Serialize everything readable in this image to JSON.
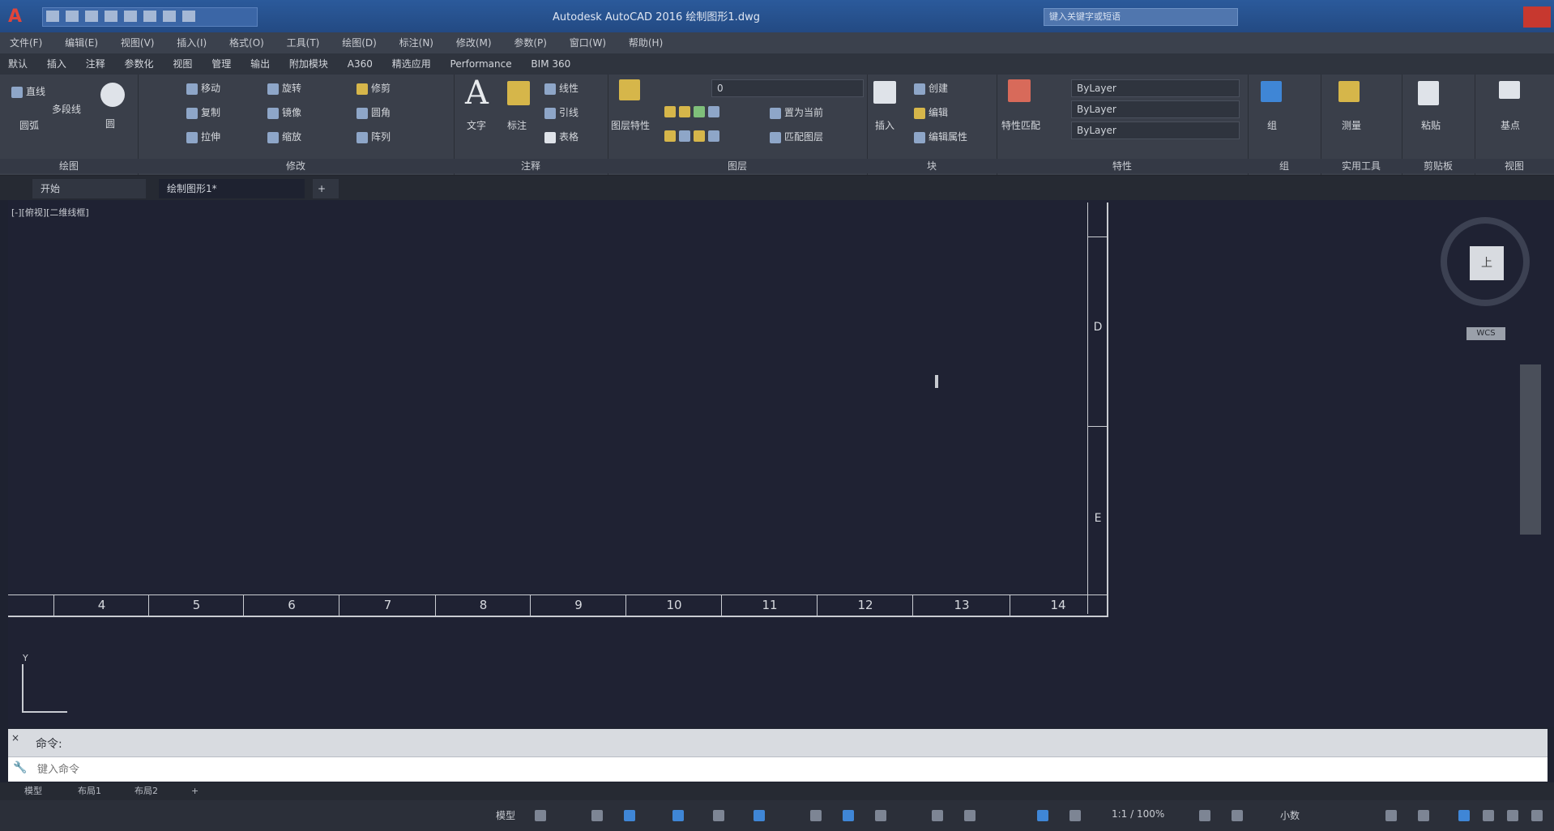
{
  "titlebar": {
    "app_logo": "A",
    "window_title": "Autodesk AutoCAD 2016   绘制图形1.dwg",
    "search_placeholder": "键入关键字或短语"
  },
  "menu": [
    "文件(F)",
    "编辑(E)",
    "视图(V)",
    "插入(I)",
    "格式(O)",
    "工具(T)",
    "绘图(D)",
    "标注(N)",
    "修改(M)",
    "参数(P)",
    "窗口(W)",
    "帮助(H)"
  ],
  "ribbon_tabs": [
    "默认",
    "插入",
    "注释",
    "参数化",
    "视图",
    "管理",
    "输出",
    "附加模块",
    "A360",
    "精选应用",
    "Performance",
    "BIM 360"
  ],
  "ribbon": {
    "draw": {
      "title": "绘图",
      "line": "直线",
      "polyline": "多段线",
      "circle": "圆",
      "arc": "圆弧"
    },
    "modify": {
      "title": "修改",
      "move": "移动",
      "rotate": "旋转",
      "trim": "修剪",
      "copy": "复制",
      "mirror": "镜像",
      "fillet": "圆角",
      "stretch": "拉伸",
      "scale": "缩放",
      "array": "阵列"
    },
    "annotation": {
      "title": "注释",
      "text": "文字",
      "dimension": "标注",
      "linear": "线性",
      "leader": "引线",
      "table": "表格"
    },
    "layers": {
      "title": "图层",
      "layer_properties": "图层特性",
      "current_layer": "0",
      "make_current": "置为当前",
      "match_layer": "匹配图层"
    },
    "block": {
      "title": "块",
      "insert": "插入",
      "create": "创建",
      "edit": "编辑",
      "edit_attributes": "编辑属性"
    },
    "properties": {
      "title": "特性",
      "match": "特性匹配",
      "color": "ByLayer",
      "linetype": "ByLayer",
      "lineweight": "ByLayer"
    },
    "groups": {
      "title": "组",
      "group": "组"
    },
    "utilities": {
      "title": "实用工具",
      "measure": "测量"
    },
    "clipboard": {
      "title": "剪贴板",
      "paste": "粘贴"
    },
    "view": {
      "title": "视图",
      "base": "基点"
    }
  },
  "file_tabs": [
    "开始",
    "绘制图形1*"
  ],
  "viewport_label": "[-][俯视][二维线框]",
  "drawing": {
    "vertical_marks": [
      "D",
      "E"
    ],
    "horizontal_marks": [
      "4",
      "5",
      "6",
      "7",
      "8",
      "9",
      "10",
      "11",
      "12",
      "13",
      "14"
    ]
  },
  "navigation": {
    "cube_face": "上",
    "wcs": "WCS"
  },
  "ucs": {
    "y_label": "Y"
  },
  "command": {
    "history_label": "命令:",
    "close_icon": "×",
    "input_placeholder": "键入命令"
  },
  "layout_tabs": [
    "模型",
    "布局1",
    "布局2"
  ],
  "status": {
    "model": "模型",
    "scale": "1:1 / 100%",
    "decimal": "小数"
  }
}
